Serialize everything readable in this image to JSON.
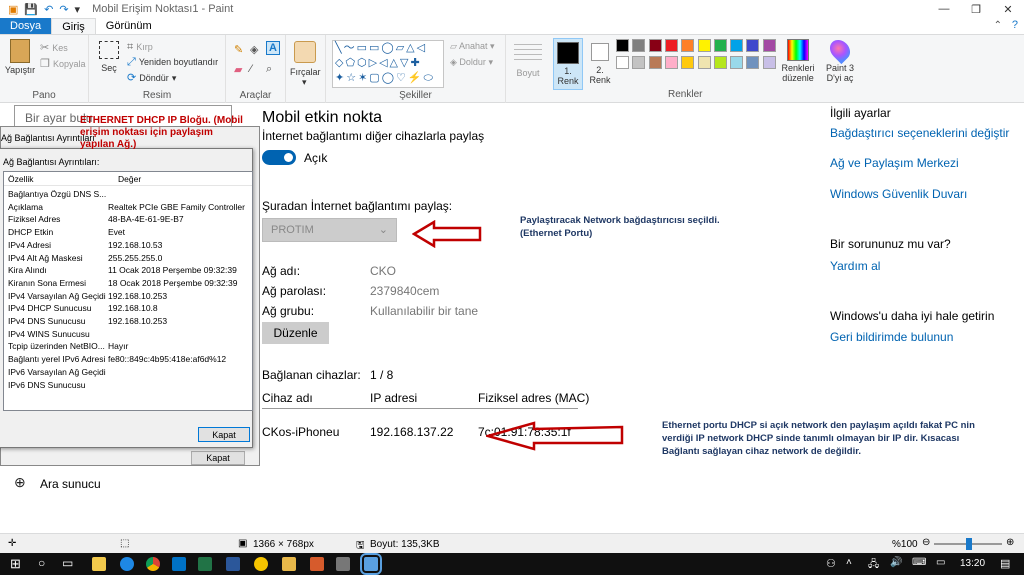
{
  "window": {
    "title": "Mobil Erişim Noktası1 - Paint",
    "controls": {
      "minimize": "—",
      "maximize": "❐",
      "close": "✕"
    }
  },
  "ribbon_tabs": [
    "Dosya",
    "Giriş",
    "Görünüm"
  ],
  "ribbon": {
    "clipboard": {
      "paste": "Yapıştır",
      "cut": "Kes",
      "copy": "Kopyala",
      "label": "Pano"
    },
    "image": {
      "select": "Seç",
      "crop": "Kırp",
      "resize": "Yeniden boyutlandır",
      "rotate": "Döndür",
      "label": "Resim"
    },
    "tools": {
      "label": "Araçlar"
    },
    "brushes": {
      "label": "Fırçalar"
    },
    "shapes": {
      "outline": "Anahat",
      "fill": "Doldur",
      "label": "Şekiller"
    },
    "size": {
      "label": "Boyut"
    },
    "colors": {
      "color1_line1": "1.",
      "color1_line2": "Renk",
      "color2_line1": "2.",
      "color2_line2": "Renk",
      "edit_line1": "Renkleri",
      "edit_line2": "düzenle",
      "paint3d_line1": "Paint 3",
      "paint3d_line2": "D'yi aç",
      "label": "Renkler",
      "palette_row1": [
        "#000000",
        "#7f7f7f",
        "#880015",
        "#ed1c24",
        "#ff7f27",
        "#fff200",
        "#22b14c",
        "#00a2e8",
        "#3f48cc",
        "#a349a4"
      ],
      "palette_row2": [
        "#ffffff",
        "#c3c3c3",
        "#b97a57",
        "#ffaec9",
        "#ffc90e",
        "#efe4b0",
        "#b5e61d",
        "#99d9ea",
        "#7092be",
        "#c8bfe7"
      ]
    }
  },
  "settings": {
    "search_placeholder": "Bir ayar bulu",
    "page_title": "Mobil etkin nokta",
    "share_desc": "İnternet bağlantımı diğer cihazlarla paylaş",
    "toggle_state": "Açık",
    "share_from": "Şuradan İnternet bağlantımı paylaş:",
    "adapter_value": "PROTIM",
    "network_name_label": "Ağ adı:",
    "network_name": "CKO",
    "password_label": "Ağ parolası:",
    "password": "2379840cem",
    "band_label": "Ağ grubu:",
    "band": "Kullanılabilir bir tane",
    "edit_button": "Düzenle",
    "connected_label": "Bağlanan cihazlar:",
    "connected_count": "1 / 8",
    "col_device": "Cihaz adı",
    "col_ip": "IP adresi",
    "col_mac": "Fiziksel adres (MAC)",
    "device": {
      "name": "CKos-iPhoneu",
      "ip": "192.168.137.22",
      "mac": "7c:01:91:78:35:1f"
    },
    "remote_label": "Ara sunucu"
  },
  "related": {
    "title": "İlgili ayarlar",
    "link1": "Bağdaştırıcı seçeneklerini değiştir",
    "link2": "Ağ ve Paylaşım Merkezi",
    "link3": "Windows Güvenlik Duvarı",
    "question": "Bir sorununuz mu var?",
    "help": "Yardım al",
    "improve": "Windows'u daha iyi hale getirin",
    "feedback": "Geri bildirimde bulunun"
  },
  "dialog": {
    "outer_title": "Ağ Bağlantısı Ayrıntıları",
    "title": "Ağ Bağlantısı Ayrıntıları",
    "subtitle": "Ağ Bağlantısı Ayrıntıları:",
    "col_property": "Özellik",
    "col_value": "Değer",
    "rows": [
      {
        "k": "Bağlantıya Özgü DNS S...",
        "v": ""
      },
      {
        "k": "Açıklama",
        "v": "Realtek PCIe GBE Family Controller"
      },
      {
        "k": "Fiziksel Adres",
        "v": "48-BA-4E-61-9E-B7"
      },
      {
        "k": "DHCP Etkin",
        "v": "Evet"
      },
      {
        "k": "IPv4 Adresi",
        "v": "192.168.10.53"
      },
      {
        "k": "IPv4 Alt Ağ Maskesi",
        "v": "255.255.255.0"
      },
      {
        "k": "Kira Alındı",
        "v": "11 Ocak 2018 Perşembe 09:32:39"
      },
      {
        "k": "Kiranın Sona Ermesi",
        "v": "18 Ocak 2018 Perşembe 09:32:39"
      },
      {
        "k": "IPv4 Varsayılan Ağ Geçidi",
        "v": "192.168.10.253"
      },
      {
        "k": "IPv4 DHCP Sunucusu",
        "v": "192.168.10.8"
      },
      {
        "k": "IPv4 DNS Sunucusu",
        "v": "192.168.10.253"
      },
      {
        "k": "IPv4 WINS Sunucusu",
        "v": ""
      },
      {
        "k": "Tcpip üzerinden NetBIO...",
        "v": "Hayır"
      },
      {
        "k": "Bağlantı yerel IPv6 Adresi",
        "v": "fe80::849c:4b95:418e:af6d%12"
      },
      {
        "k": "IPv6 Varsayılan Ağ Geçidi",
        "v": ""
      },
      {
        "k": "IPv6 DNS Sunucusu",
        "v": ""
      }
    ],
    "close_button": "Kapat",
    "close_button_back": "Kapat"
  },
  "annotations": {
    "dhcp_block": "ETHERNET DHCP IP Bloğu. (Mobil erişim noktası için paylaşım yapılan Ağ.)",
    "adapter_note_line1": "Paylaştıracak Network bağdaştırıcısı seçildi.",
    "adapter_note_line2": "(Ethernet Portu)",
    "device_note_line1": "Ethernet portu DHCP si açık network den paylaşım açıldı fakat PC nin",
    "device_note_line2": "verdiği IP network DHCP sinde tanımlı olmayan bir IP dir. Kısacası",
    "device_note_line3": "Bağlantı sağlayan cihaz network de değildir."
  },
  "statusbar": {
    "dimensions": "1366 × 768px",
    "size": "Boyut: 135,3KB",
    "zoom": "%100"
  },
  "taskbar": {
    "time": "13:20"
  },
  "colors": {
    "accent": "#0063b1",
    "annotation_red": "#c00000",
    "note_navy": "#1f3864",
    "toggle_on": "#0063b1"
  }
}
